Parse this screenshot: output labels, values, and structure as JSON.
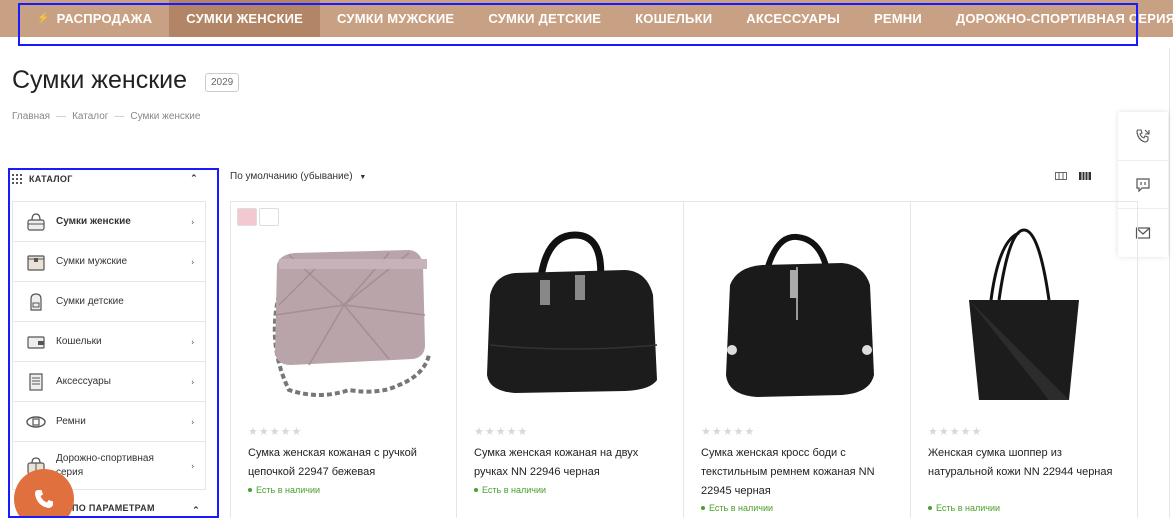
{
  "nav": {
    "items": [
      {
        "label": "РАСПРОДАЖА",
        "active": false
      },
      {
        "label": "СУМКИ ЖЕНСКИЕ",
        "active": true
      },
      {
        "label": "СУМКИ МУЖСКИЕ",
        "active": false
      },
      {
        "label": "СУМКИ ДЕТСКИЕ",
        "active": false
      },
      {
        "label": "КОШЕЛЬКИ",
        "active": false
      },
      {
        "label": "АКСЕССУАРЫ",
        "active": false
      },
      {
        "label": "РЕМНИ",
        "active": false
      },
      {
        "label": "ДОРОЖНО-СПОРТИВНАЯ СЕРИЯ",
        "active": false
      }
    ]
  },
  "page": {
    "title": "Сумки женские",
    "count": "2029"
  },
  "breadcrumb": [
    "Главная",
    "Каталог",
    "Сумки женские"
  ],
  "breadcrumb_sep": "—",
  "catalog": {
    "heading": "КАТАЛОГ",
    "items": [
      {
        "label": "Сумки женские",
        "icon": "women-bag-icon",
        "active": true,
        "arrow": true
      },
      {
        "label": "Сумки мужские",
        "icon": "men-bag-icon",
        "active": false,
        "arrow": true
      },
      {
        "label": "Сумки детские",
        "icon": "backpack-icon",
        "active": false,
        "arrow": false
      },
      {
        "label": "Кошельки",
        "icon": "wallet-icon",
        "active": false,
        "arrow": true
      },
      {
        "label": "Аксессуары",
        "icon": "notebook-icon",
        "active": false,
        "arrow": true
      },
      {
        "label": "Ремни",
        "icon": "belt-icon",
        "active": false,
        "arrow": true
      },
      {
        "label": "Дорожно-спортивная серия",
        "icon": "travel-bag-icon",
        "active": false,
        "arrow": true
      }
    ],
    "params_heading": "ПО ПАРАМЕТРАМ"
  },
  "sort": {
    "label": "По умолчанию (убывание)"
  },
  "products": [
    {
      "name": "Сумка женская кожаная с ручкой цепочкой 22947 бежевая",
      "stock": "Есть в наличии",
      "color": "#b9a4aa"
    },
    {
      "name": "Сумка женская кожаная на двух ручках NN 22946 черная",
      "stock": "Есть в наличии",
      "color": "#1a1a1a"
    },
    {
      "name": "Сумка женская кросс боди с текстильным ремнем кожаная NN 22945 черная",
      "stock": "Есть в наличии",
      "color": "#1a1a1a"
    },
    {
      "name": "Женская сумка шоппер из натуральной кожи NN 22944 черная",
      "stock": "Есть в наличии",
      "color": "#1a1a1a"
    }
  ],
  "colors": {
    "nav_bg": "#c8a184",
    "nav_active": "#b18565",
    "in_stock": "#4aa02c",
    "phone_btn": "#e0703e",
    "outline": "#1a1aff"
  }
}
